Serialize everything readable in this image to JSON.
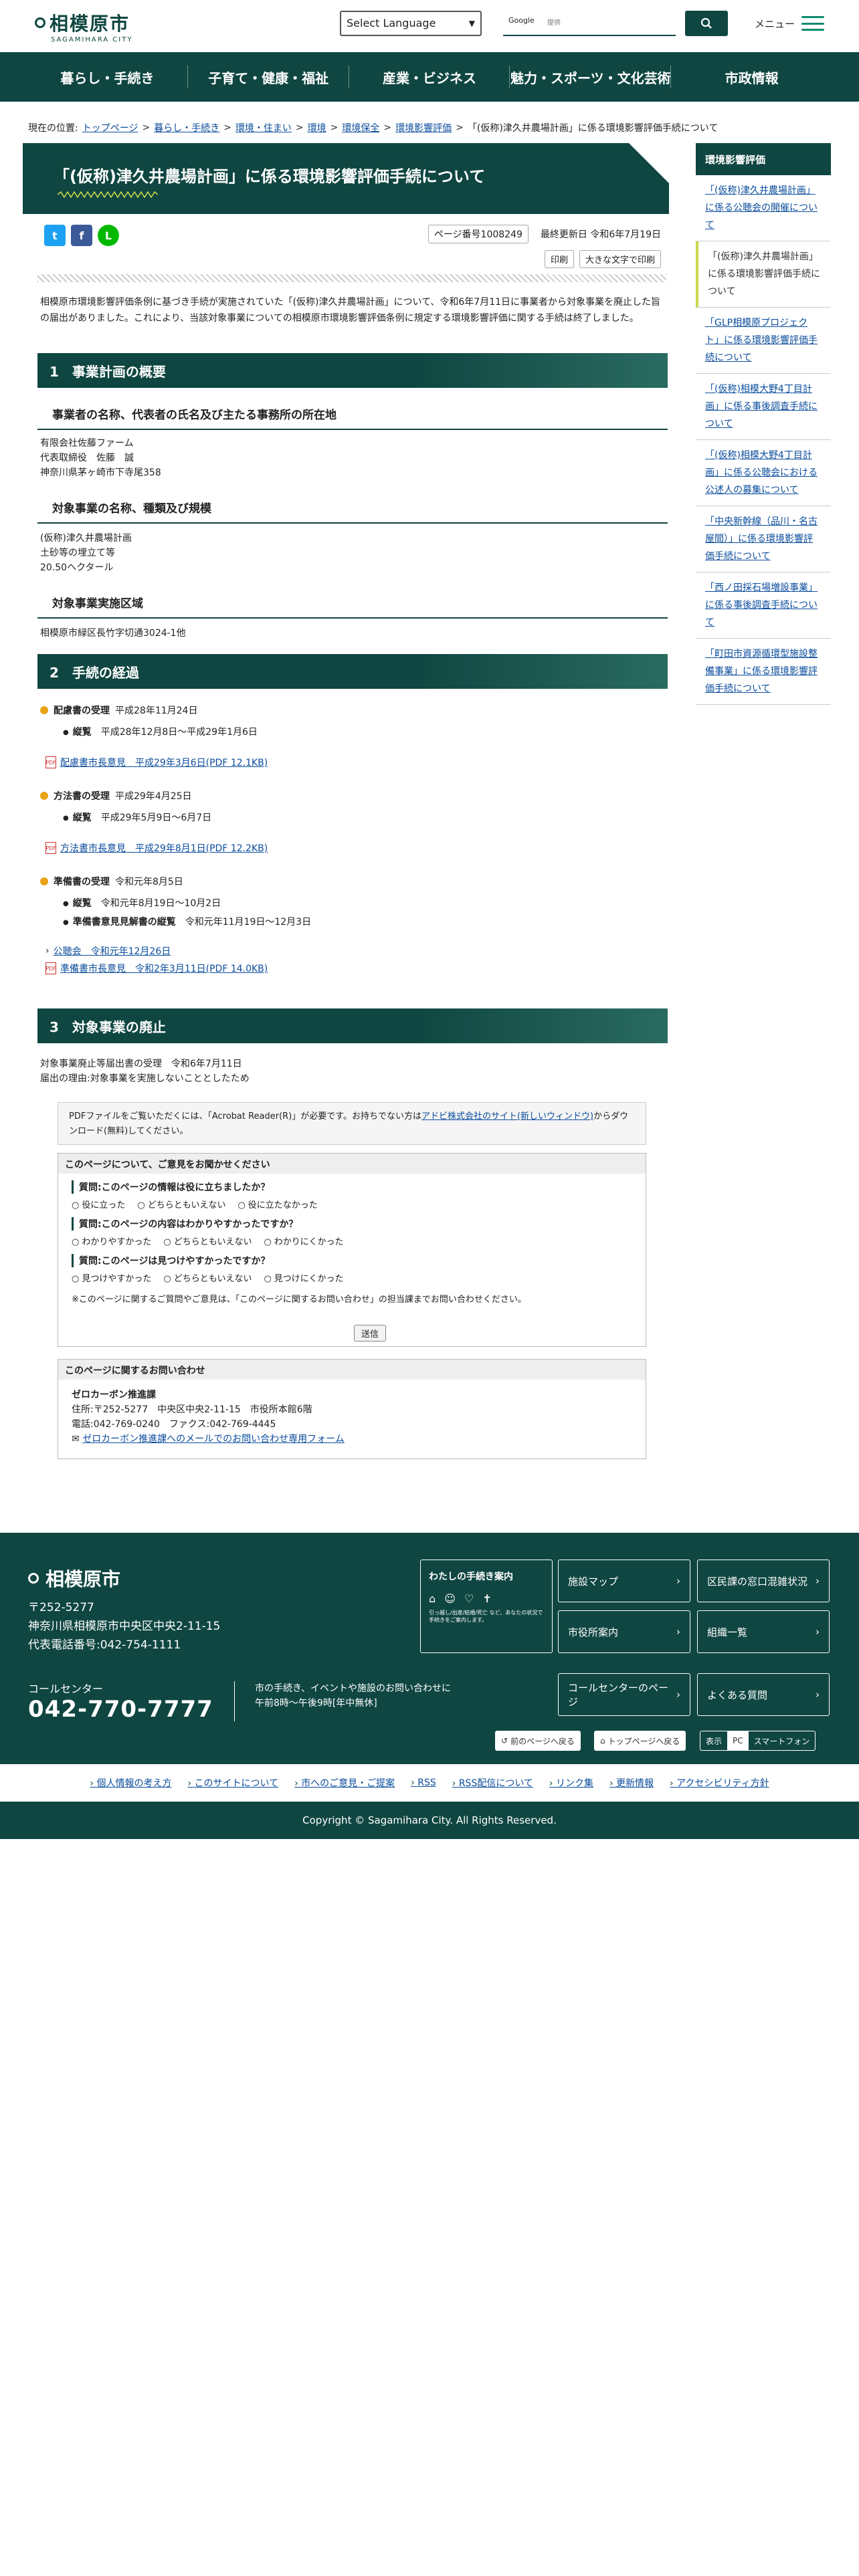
{
  "header": {
    "logo_main": "相模原市",
    "logo_sub": "SAGAMIHARA CITY",
    "language": "Select Language",
    "search_provider": "Google",
    "search_placeholder": "提供",
    "menu_label": "メニュー"
  },
  "nav": [
    "暮らし・手続き",
    "子育て・健康・福祉",
    "産業・ビジネス",
    "魅力・スポーツ・文化芸術",
    "市政情報"
  ],
  "breadcrumb": {
    "prefix": "現在の位置:",
    "items": [
      "トップページ",
      "暮らし・手続き",
      "環境・住まい",
      "環境",
      "環境保全",
      "環境影響評価"
    ],
    "current": "「(仮称)津久井農場計画」に係る環境影響評価手続について"
  },
  "page": {
    "title": "「(仮称)津久井農場計画」に係る環境影響評価手続について",
    "page_no": "ページ番号1008249",
    "updated": "最終更新日 令和6年7月19日",
    "print": "印刷",
    "print_large": "大きな文字で印刷",
    "intro": "相模原市環境影響評価条例に基づき手続が実施されていた「(仮称)津久井農場計画」について、令和6年7月11日に事業者から対象事業を廃止した旨の届出がありました。これにより、当該対象事業についての相模原市環境影響評価条例に規定する環境影響評価に関する手続は終了しました。"
  },
  "s1": {
    "title": "1　事業計画の概要",
    "h_a": "事業者の名称、代表者の氏名及び主たる事務所の所在地",
    "a": [
      "有限会社佐藤ファーム",
      "代表取締役　佐藤　誠",
      "神奈川県茅ヶ崎市下寺尾358"
    ],
    "h_b": "対象事業の名称、種類及び規模",
    "b": [
      "(仮称)津久井農場計画",
      "土砂等の埋立て等",
      "20.50ヘクタール"
    ],
    "h_c": "対象事業実施区域",
    "c": "相模原市緑区長竹字切通3024-1他"
  },
  "s2": {
    "title": "2　手続の経過",
    "p1": {
      "label": "配慮書の受理",
      "date": "平成28年11月24日",
      "item_l": "縦覧",
      "item_v": "平成28年12月8日～平成29年1月6日",
      "link": "配慮書市長意見　平成29年3月6日(PDF 12.1KB)"
    },
    "p2": {
      "label": "方法書の受理",
      "date": "平成29年4月25日",
      "item_l": "縦覧",
      "item_v": "平成29年5月9日～6月7日",
      "link": "方法書市長意見　平成29年8月1日(PDF 12.2KB)"
    },
    "p3": {
      "label": "準備書の受理",
      "date": "令和元年8月5日",
      "item_l": "縦覧",
      "item_v": "令和元年8月19日～10月2日",
      "item2_l": "準備書意見見解書の縦覧",
      "item2_v": "令和元年11月19日～12月3日",
      "link1": "公聴会　令和元年12月26日",
      "link2": "準備書市長意見　令和2年3月11日(PDF 14.0KB)"
    }
  },
  "s3": {
    "title": "3　対象事業の廃止",
    "l1": "対象事業廃止等届出書の受理　令和6年7月11日",
    "l2": "届出の理由:対象事業を実施しないこととしたため"
  },
  "pdfnote": {
    "text": "PDFファイルをご覧いただくには、「Acrobat Reader(R)」が必要です。お持ちでない方は",
    "link": "アドビ株式会社のサイト(新しいウィンドウ)",
    "after": "からダウンロード(無料)してください。"
  },
  "survey": {
    "title": "このページについて、ご意見をお聞かせください",
    "q1": "質問:このページの情報は役に立ちましたか？",
    "q1o": [
      "役に立った",
      "どちらともいえない",
      "役に立たなかった"
    ],
    "q2": "質問:このページの内容はわかりやすかったですか？",
    "q2o": [
      "わかりやすかった",
      "どちらともいえない",
      "わかりにくかった"
    ],
    "q3": "質問:このページは見つけやすかったですか？",
    "q3o": [
      "見つけやすかった",
      "どちらともいえない",
      "見つけにくかった"
    ],
    "note": "※このページに関するご質問やご意見は、「このページに関するお問い合わせ」の担当課までお問い合わせください。",
    "send": "送信"
  },
  "contact": {
    "title": "このページに関するお問い合わせ",
    "dept": "ゼロカーボン推進課",
    "addr": "住所:〒252-5277　中央区中央2-11-15　市役所本館6階",
    "tel": "電話:042-769-0240　ファクス:042-769-4445",
    "form": "ゼロカーボン推進課へのメールでのお問い合わせ専用フォーム"
  },
  "side": {
    "title": "環境影響評価",
    "items": [
      "「(仮称)津久井農場計画」に係る公聴会の開催について",
      "「(仮称)津久井農場計画」に係る環境影響評価手続について",
      "「GLP相模原プロジェクト」に係る環境影響評価手続について",
      "「(仮称)相模大野4丁目計画」に係る事後調査手続について",
      "「(仮称)相模大野4丁目計画」に係る公聴会における公述人の募集について",
      "「中央新幹線（品川・名古屋間）」に係る環境影響評価手続について",
      "「西ノ田採石場増設事業」に係る事後調査手続について",
      "「町田市資源循環型施設整備事業」に係る環境影響評価手続について"
    ]
  },
  "footer": {
    "city": "相模原市",
    "addr": [
      "〒252-5277",
      "神奈川県相模原市中央区中央2-11-15",
      "代表電話番号:042-754-1111"
    ],
    "cc": "コールセンター",
    "tel": "042-770-7777",
    "hours": [
      "市の手続き、イベントや施設のお問い合わせに",
      "午前8時～午後9時[年中無休]"
    ],
    "guide": "わたしの手続き案内",
    "guide_small": "引っ越し/出産/結婚/死亡 など、あなたの状況で手続きをご案内します。",
    "btns": [
      "施設マップ",
      "区民課の窓口混雑状況",
      "市役所案内",
      "組織一覧",
      "コールセンターのページ",
      "よくある質問"
    ],
    "back": "前のページへ戻る",
    "top": "トップページへ戻る",
    "disp": "表示",
    "pc": "PC",
    "sp": "スマートフォン",
    "links": [
      "個人情報の考え方",
      "このサイトについて",
      "市へのご意見・ご提案",
      "RSS",
      "RSS配信について",
      "リンク集",
      "更新情報",
      "アクセシビリティ方針"
    ],
    "copy": "Copyright © Sagamihara City. All Rights Reserved."
  }
}
